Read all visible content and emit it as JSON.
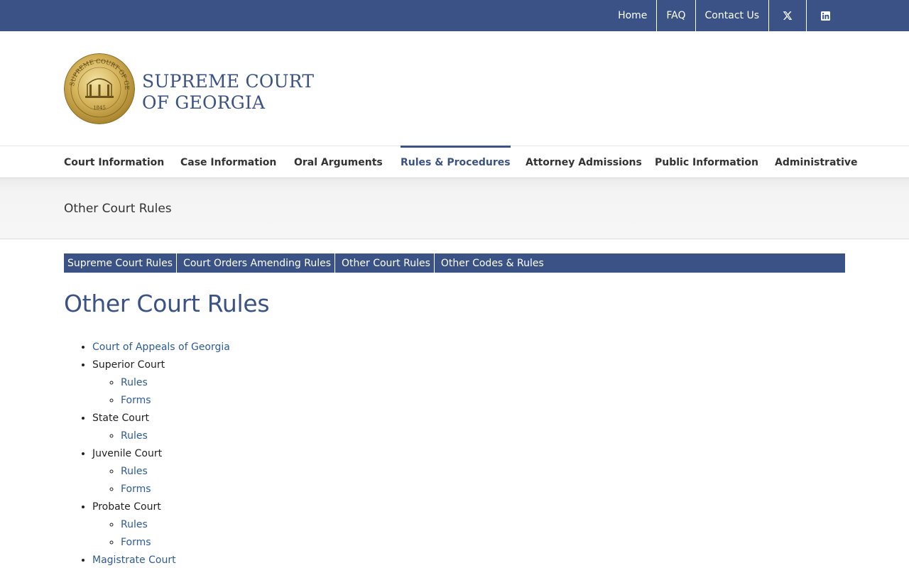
{
  "topnav": {
    "home": "Home",
    "faq": "FAQ",
    "contact": "Contact Us"
  },
  "brand": {
    "line1": "SUPREME COURT",
    "line2": "OF GEORGIA",
    "seal_text": "SUPREME COURT OF GEORGIA",
    "seal_year": "1845"
  },
  "mainnav": {
    "items": [
      {
        "label": "Court Information"
      },
      {
        "label": "Case Information"
      },
      {
        "label": "Oral Arguments"
      },
      {
        "label": "Rules & Procedures"
      },
      {
        "label": "Attorney Admissions"
      },
      {
        "label": "Public Information"
      },
      {
        "label": "Administrative"
      }
    ]
  },
  "titleband": {
    "title": "Other Court Rules"
  },
  "subnav": {
    "items": [
      {
        "label": "Supreme Court Rules"
      },
      {
        "label": "Court Orders Amending Rules"
      },
      {
        "label": "Other Court Rules"
      },
      {
        "label": "Other Codes & Rules"
      }
    ]
  },
  "page": {
    "heading": "Other Court Rules"
  },
  "courts": {
    "appeals": "Court of Appeals of Georgia",
    "superior": {
      "label": "Superior Court",
      "rules": "Rules",
      "forms": "Forms"
    },
    "state": {
      "label": "State Court",
      "rules": "Rules"
    },
    "juvenile": {
      "label": "Juvenile Court",
      "rules": "Rules",
      "forms": "Forms"
    },
    "probate": {
      "label": "Probate Court",
      "rules": "Rules",
      "forms": "Forms"
    },
    "magistrate": "Magistrate Court"
  },
  "colors": {
    "brand_blue": "#3a5285",
    "link_blue": "#2d5b96",
    "seal_gold": "#c9a94a"
  },
  "icons": {
    "x": "x-twitter-icon",
    "linkedin": "linkedin-icon",
    "seal": "georgia-seal-logo"
  }
}
